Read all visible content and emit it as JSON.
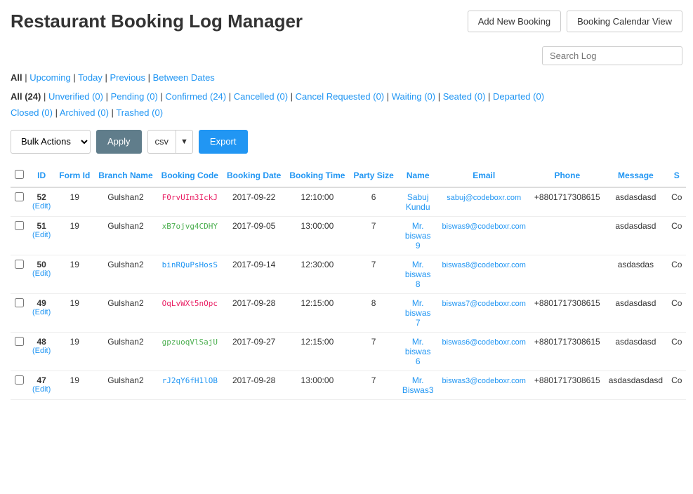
{
  "header": {
    "title": "Restaurant Booking Log Manager",
    "buttons": [
      {
        "label": "Add New Booking",
        "name": "add-new-booking-button"
      },
      {
        "label": "Booking Calendar View",
        "name": "booking-calendar-button"
      }
    ]
  },
  "search": {
    "placeholder": "Search Log"
  },
  "filters": {
    "items": [
      {
        "label": "All",
        "active": true
      },
      {
        "label": "Upcoming",
        "active": false
      },
      {
        "label": "Today",
        "active": false
      },
      {
        "label": "Previous",
        "active": false
      },
      {
        "label": "Between Dates",
        "active": false
      }
    ]
  },
  "status_bar": {
    "items": [
      {
        "label": "All (24)",
        "active": true
      },
      {
        "label": "Unverified (0)",
        "active": false
      },
      {
        "label": "Pending (0)",
        "active": false
      },
      {
        "label": "Confirmed (24)",
        "active": false
      },
      {
        "label": "Cancelled (0)",
        "active": false
      },
      {
        "label": "Cancel Requested (0)",
        "active": false
      },
      {
        "label": "Waiting (0)",
        "active": false
      },
      {
        "label": "Seated (0)",
        "active": false
      },
      {
        "label": "Departed (0)",
        "active": false
      },
      {
        "label": "Closed (0)",
        "active": false
      },
      {
        "label": "Archived (0)",
        "active": false
      },
      {
        "label": "Trashed (0)",
        "active": false
      }
    ]
  },
  "toolbar": {
    "bulk_label": "Bulk Actions",
    "apply_label": "Apply",
    "csv_label": "csv",
    "export_label": "Export"
  },
  "table": {
    "columns": [
      "ID",
      "Form Id",
      "Branch Name",
      "Booking Code",
      "Booking Date",
      "Booking Time",
      "Party Size",
      "Name",
      "Email",
      "Phone",
      "Message",
      "S"
    ],
    "rows": [
      {
        "id": "52",
        "form_id": "19",
        "branch": "Gulshan2",
        "booking_code": "F0rvUIm3IckJ",
        "code_color": "pink",
        "date": "2017-09-22",
        "time": "12:10:00",
        "party": "6",
        "name": "Sabuj Kundu",
        "email": "sabuj@codeboxr.com",
        "phone": "+8801717308615",
        "message": "asdasdasd",
        "status": "Co"
      },
      {
        "id": "51",
        "form_id": "19",
        "branch": "Gulshan2",
        "booking_code": "xB7ojvg4CDHY",
        "code_color": "green",
        "date": "2017-09-05",
        "time": "13:00:00",
        "party": "7",
        "name": "Mr. biswas 9",
        "email": "biswas9@codeboxr.com",
        "phone": "",
        "message": "asdasdasd",
        "status": "Co"
      },
      {
        "id": "50",
        "form_id": "19",
        "branch": "Gulshan2",
        "booking_code": "binRQuPsHosS",
        "code_color": "blue",
        "date": "2017-09-14",
        "time": "12:30:00",
        "party": "7",
        "name": "Mr. biswas 8",
        "email": "biswas8@codeboxr.com",
        "phone": "",
        "message": "asdasdas",
        "status": "Co"
      },
      {
        "id": "49",
        "form_id": "19",
        "branch": "Gulshan2",
        "booking_code": "OqLvWXt5nOpc",
        "code_color": "pink",
        "date": "2017-09-28",
        "time": "12:15:00",
        "party": "8",
        "name": "Mr. biswas 7",
        "email": "biswas7@codeboxr.com",
        "phone": "+8801717308615",
        "message": "asdasdasd",
        "status": "Co"
      },
      {
        "id": "48",
        "form_id": "19",
        "branch": "Gulshan2",
        "booking_code": "gpzuoqVlSajU",
        "code_color": "green",
        "date": "2017-09-27",
        "time": "12:15:00",
        "party": "7",
        "name": "Mr. biswas 6",
        "email": "biswas6@codeboxr.com",
        "phone": "+8801717308615",
        "message": "asdasdasd",
        "status": "Co"
      },
      {
        "id": "47",
        "form_id": "19",
        "branch": "Gulshan2",
        "booking_code": "rJ2qY6fH1lOB",
        "code_color": "blue",
        "date": "2017-09-28",
        "time": "13:00:00",
        "party": "7",
        "name": "Mr. Biswas3",
        "email": "biswas3@codeboxr.com",
        "phone": "+8801717308615",
        "message": "asdasdasdasd",
        "status": "Co"
      }
    ]
  }
}
